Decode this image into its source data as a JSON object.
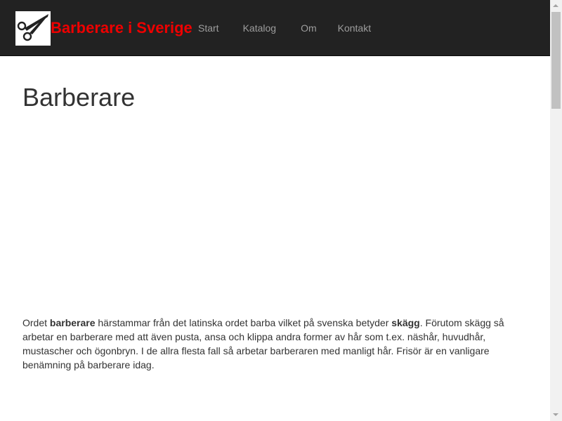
{
  "header": {
    "brand": "Barberare i Sverige",
    "logo_icon": "scissors-icon",
    "nav": [
      "Start",
      "Katalog",
      "Om",
      "Kontakt"
    ],
    "brand_color": "#ee0000",
    "bar_color": "#222222"
  },
  "main": {
    "title": "Barberare",
    "intro": {
      "p1": "Ordet ",
      "b1": "barberare",
      "p2": " härstammar från det latinska ordet barba vilket på svenska betyder ",
      "b2": "skägg",
      "p3": ". Förutom skägg så arbetar en barberare med att även pusta, ansa och klippa andra former av hår som t.ex. näshår, huvudhår, mustascher och ögonbryn. I de allra flesta fall så arbetar barberaren med manligt hår. Frisör är en vanligare benämning på barberare idag."
    }
  }
}
